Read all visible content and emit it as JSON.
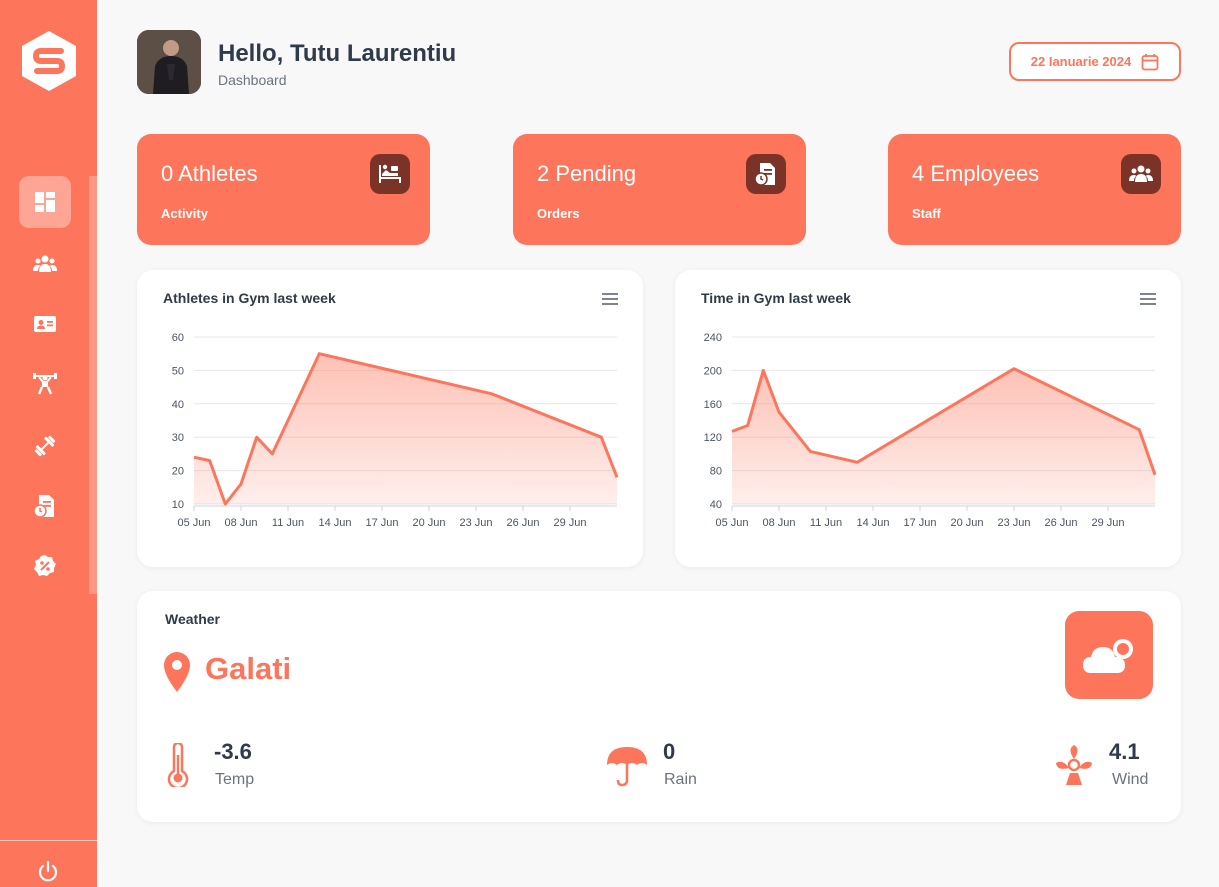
{
  "sidebar": {
    "logo_letter": "S",
    "nav": [
      "dashboard",
      "users",
      "id-card",
      "athlete",
      "dumbbell",
      "orders",
      "discount"
    ]
  },
  "header": {
    "greeting": "Hello, Tutu Laurentiu",
    "subtitle": "Dashboard",
    "date": "22 Ianuarie 2024"
  },
  "stats": [
    {
      "value": "0 Athletes",
      "label": "Activity",
      "icon": "bed-person-icon"
    },
    {
      "value": "2 Pending",
      "label": "Orders",
      "icon": "order-clock-icon"
    },
    {
      "value": "4 Employees",
      "label": "Staff",
      "icon": "people-group-icon"
    }
  ],
  "charts": {
    "athletes": {
      "title": "Athletes in Gym last week"
    },
    "time": {
      "title": "Time in Gym last week"
    }
  },
  "chart_data": [
    {
      "type": "area",
      "title": "Athletes in Gym last week",
      "x_ticks": [
        "05 Jun",
        "08 Jun",
        "11 Jun",
        "14 Jun",
        "17 Jun",
        "20 Jun",
        "23 Jun",
        "26 Jun",
        "29 Jun"
      ],
      "y_ticks": [
        10,
        20,
        30,
        40,
        50,
        60
      ],
      "ylim": [
        10,
        60
      ],
      "x": [
        "2023-06-05",
        "2023-06-06",
        "2023-06-07",
        "2023-06-08",
        "2023-06-09",
        "2023-06-10",
        "2023-06-13",
        "2023-06-24",
        "2023-07-01",
        "2023-07-02"
      ],
      "values": [
        24,
        23,
        10,
        16,
        30,
        25,
        55,
        43,
        30,
        18
      ],
      "color": "#fd765c",
      "grid": true
    },
    {
      "type": "area",
      "title": "Time in Gym last week",
      "x_ticks": [
        "05 Jun",
        "08 Jun",
        "11 Jun",
        "14 Jun",
        "17 Jun",
        "20 Jun",
        "23 Jun",
        "26 Jun",
        "29 Jun"
      ],
      "y_ticks": [
        40,
        80,
        120,
        160,
        200,
        240
      ],
      "ylim": [
        40,
        240
      ],
      "x": [
        "2023-06-05",
        "2023-06-06",
        "2023-06-07",
        "2023-06-08",
        "2023-06-10",
        "2023-06-13",
        "2023-06-23",
        "2023-07-01",
        "2023-07-02"
      ],
      "values": [
        127,
        134,
        200,
        150,
        103,
        90,
        202,
        129,
        75
      ],
      "color": "#fd765c",
      "grid": true
    }
  ],
  "weather": {
    "title": "Weather",
    "city": "Galati",
    "temp_value": "-3.6",
    "temp_label": "Temp",
    "rain_value": "0",
    "rain_label": "Rain",
    "wind_value": "4.1",
    "wind_label": "Wind"
  },
  "colors": {
    "accent": "#fd765c",
    "dark_accent": "#7b3328",
    "text": "#2f3a4a"
  }
}
